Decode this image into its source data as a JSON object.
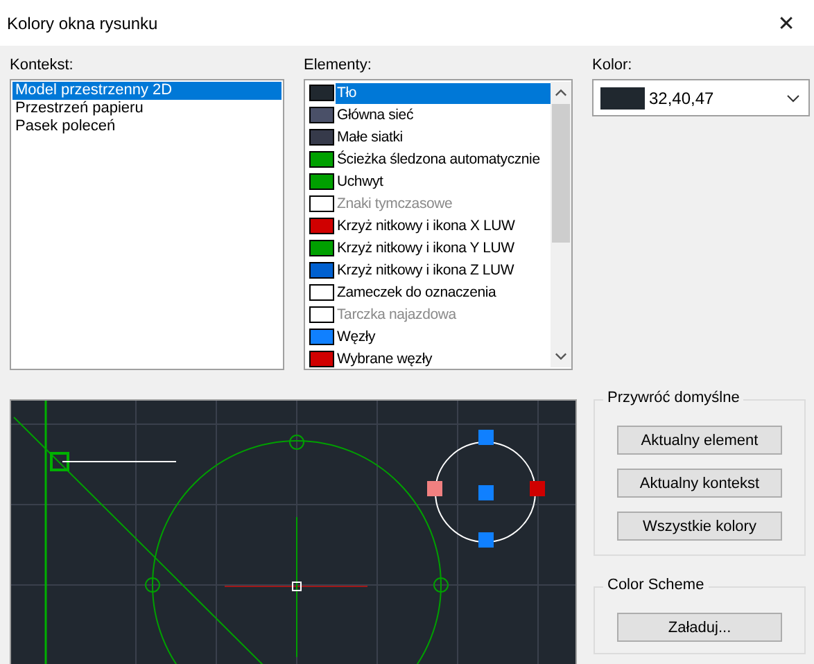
{
  "window": {
    "title": "Kolory okna rysunku",
    "close": "✕"
  },
  "context": {
    "label": "Kontekst:",
    "items": [
      {
        "label": "Model przestrzenny 2D",
        "selected": true
      },
      {
        "label": "Przestrzeń papieru",
        "selected": false
      },
      {
        "label": "Pasek poleceń",
        "selected": false
      }
    ]
  },
  "elements": {
    "label": "Elementy:",
    "items": [
      {
        "label": "Tło",
        "color": "#20282f",
        "selected": true,
        "disabled": false
      },
      {
        "label": "Główna sieć",
        "color": "#4a5068",
        "selected": false,
        "disabled": false
      },
      {
        "label": "Małe siatki",
        "color": "#363a4a",
        "selected": false,
        "disabled": false
      },
      {
        "label": "Ścieżka śledzona automatycznie",
        "color": "#00a000",
        "selected": false,
        "disabled": false
      },
      {
        "label": "Uchwyt",
        "color": "#00a000",
        "selected": false,
        "disabled": false
      },
      {
        "label": "Znaki tymczasowe",
        "color": "#ffffff",
        "selected": false,
        "disabled": true
      },
      {
        "label": "Krzyż nitkowy i ikona X LUW",
        "color": "#d00000",
        "selected": false,
        "disabled": false
      },
      {
        "label": "Krzyż nitkowy i ikona Y LUW",
        "color": "#00a000",
        "selected": false,
        "disabled": false
      },
      {
        "label": "Krzyż nitkowy i ikona Z LUW",
        "color": "#0060d0",
        "selected": false,
        "disabled": false
      },
      {
        "label": "Zameczek do oznaczenia",
        "color": "#ffffff",
        "selected": false,
        "disabled": false
      },
      {
        "label": "Tarczka najazdowa",
        "color": "#ffffff",
        "selected": false,
        "disabled": true
      },
      {
        "label": "Węzły",
        "color": "#1080ff",
        "selected": false,
        "disabled": false
      },
      {
        "label": "Wybrane węzły",
        "color": "#d00000",
        "selected": false,
        "disabled": false
      }
    ]
  },
  "color": {
    "label": "Kolor:",
    "value": "32,40,47",
    "color": "#20282f"
  },
  "restore": {
    "title": "Przywróć domyślne",
    "buttons": [
      "Aktualny element",
      "Aktualny kontekst",
      "Wszystkie kolory"
    ]
  },
  "scheme": {
    "title": "Color Scheme",
    "buttons": [
      "Załaduj..."
    ]
  }
}
